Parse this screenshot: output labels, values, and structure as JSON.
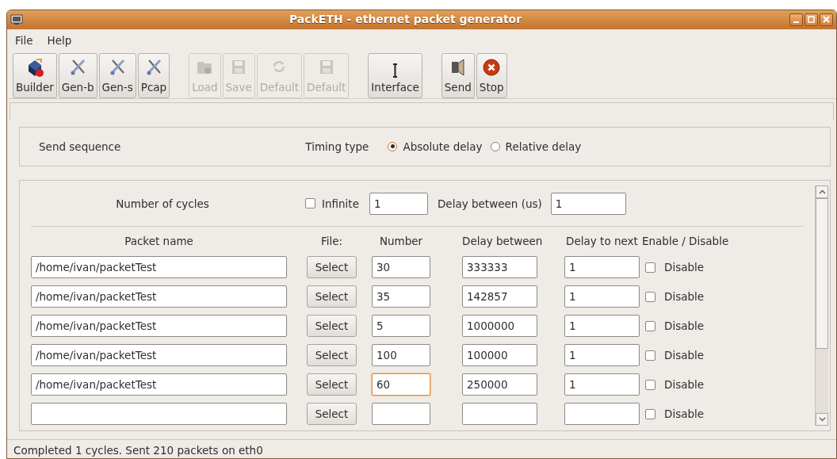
{
  "window": {
    "title": "PackETH - ethernet packet generator"
  },
  "menu": [
    "File",
    "Help"
  ],
  "toolbar": [
    {
      "buttons": [
        {
          "label": "Builder",
          "disabled": false
        },
        {
          "label": "Gen-b",
          "disabled": false
        },
        {
          "label": "Gen-s",
          "disabled": false
        },
        {
          "label": "Pcap",
          "disabled": false
        }
      ]
    },
    {
      "buttons": [
        {
          "label": "Load",
          "disabled": true
        },
        {
          "label": "Save",
          "disabled": true
        },
        {
          "label": "Default",
          "disabled": true
        },
        {
          "label": "Default",
          "disabled": true
        }
      ]
    },
    {
      "buttons": [
        {
          "label": "Interface",
          "disabled": false
        }
      ]
    },
    {
      "buttons": [
        {
          "label": "Send",
          "disabled": false
        },
        {
          "label": "Stop",
          "disabled": false
        }
      ]
    }
  ],
  "send_sequence": {
    "label": "Send sequence",
    "timing_label": "Timing type",
    "options": [
      {
        "label": "Absolute delay",
        "selected": true
      },
      {
        "label": "Relative delay",
        "selected": false
      }
    ]
  },
  "cycles": {
    "label": "Number of cycles",
    "infinite": {
      "label": "Infinite",
      "checked": false
    },
    "value": "1",
    "delay_label": "Delay between (us)",
    "delay_value": "1"
  },
  "table": {
    "columns": [
      "Packet name",
      "File:",
      "Number",
      "Delay between",
      "Delay to next",
      "Enable / Disable"
    ],
    "rows": [
      {
        "packet_name": "/home/ivan/packetTest",
        "button": "Select",
        "number": "30",
        "number_focused": false,
        "delay_between": "333333",
        "delay_to_next": "1",
        "disable": {
          "label": "Disable",
          "checked": false
        }
      },
      {
        "packet_name": "/home/ivan/packetTest",
        "button": "Select",
        "number": "35",
        "number_focused": false,
        "delay_between": "142857",
        "delay_to_next": "1",
        "disable": {
          "label": "Disable",
          "checked": false
        }
      },
      {
        "packet_name": "/home/ivan/packetTest",
        "button": "Select",
        "number": "5",
        "number_focused": false,
        "delay_between": "1000000",
        "delay_to_next": "1",
        "disable": {
          "label": "Disable",
          "checked": false
        }
      },
      {
        "packet_name": "/home/ivan/packetTest",
        "button": "Select",
        "number": "100",
        "number_focused": false,
        "delay_between": "100000",
        "delay_to_next": "1",
        "disable": {
          "label": "Disable",
          "checked": false
        }
      },
      {
        "packet_name": "/home/ivan/packetTest",
        "button": "Select",
        "number": "60",
        "number_focused": true,
        "delay_between": "250000",
        "delay_to_next": "1",
        "disable": {
          "label": "Disable",
          "checked": false
        }
      },
      {
        "button": "Select",
        "number_focused": false,
        "disable": {
          "label": "Disable",
          "checked": false
        }
      }
    ]
  },
  "status_bar": "Completed 1 cycles. Sent 210 packets on eth0"
}
